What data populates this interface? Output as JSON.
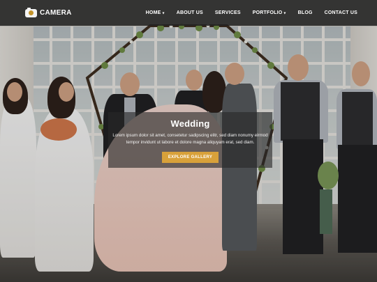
{
  "brand": {
    "name": "CAMERA",
    "accent": "#d8a13a",
    "icon": "camera-icon"
  },
  "nav": {
    "items": [
      {
        "label": "HOME",
        "dropdown": true
      },
      {
        "label": "ABOUT US",
        "dropdown": false
      },
      {
        "label": "SERVICES",
        "dropdown": false
      },
      {
        "label": "PORTFOLIO",
        "dropdown": true
      },
      {
        "label": "BLOG",
        "dropdown": false
      },
      {
        "label": "CONTACT US",
        "dropdown": false
      }
    ]
  },
  "hero": {
    "title": "Wedding",
    "text": "Lorem ipsum dolor sit amet, consetetur sadipscing elitr, sed diam nonumy eirmod tempor invidunt ut labore et dolore magna aliquyam erat, sed diam.",
    "cta_label": "EXPLORE GALLERY",
    "image": "wedding-ceremony-photo"
  }
}
